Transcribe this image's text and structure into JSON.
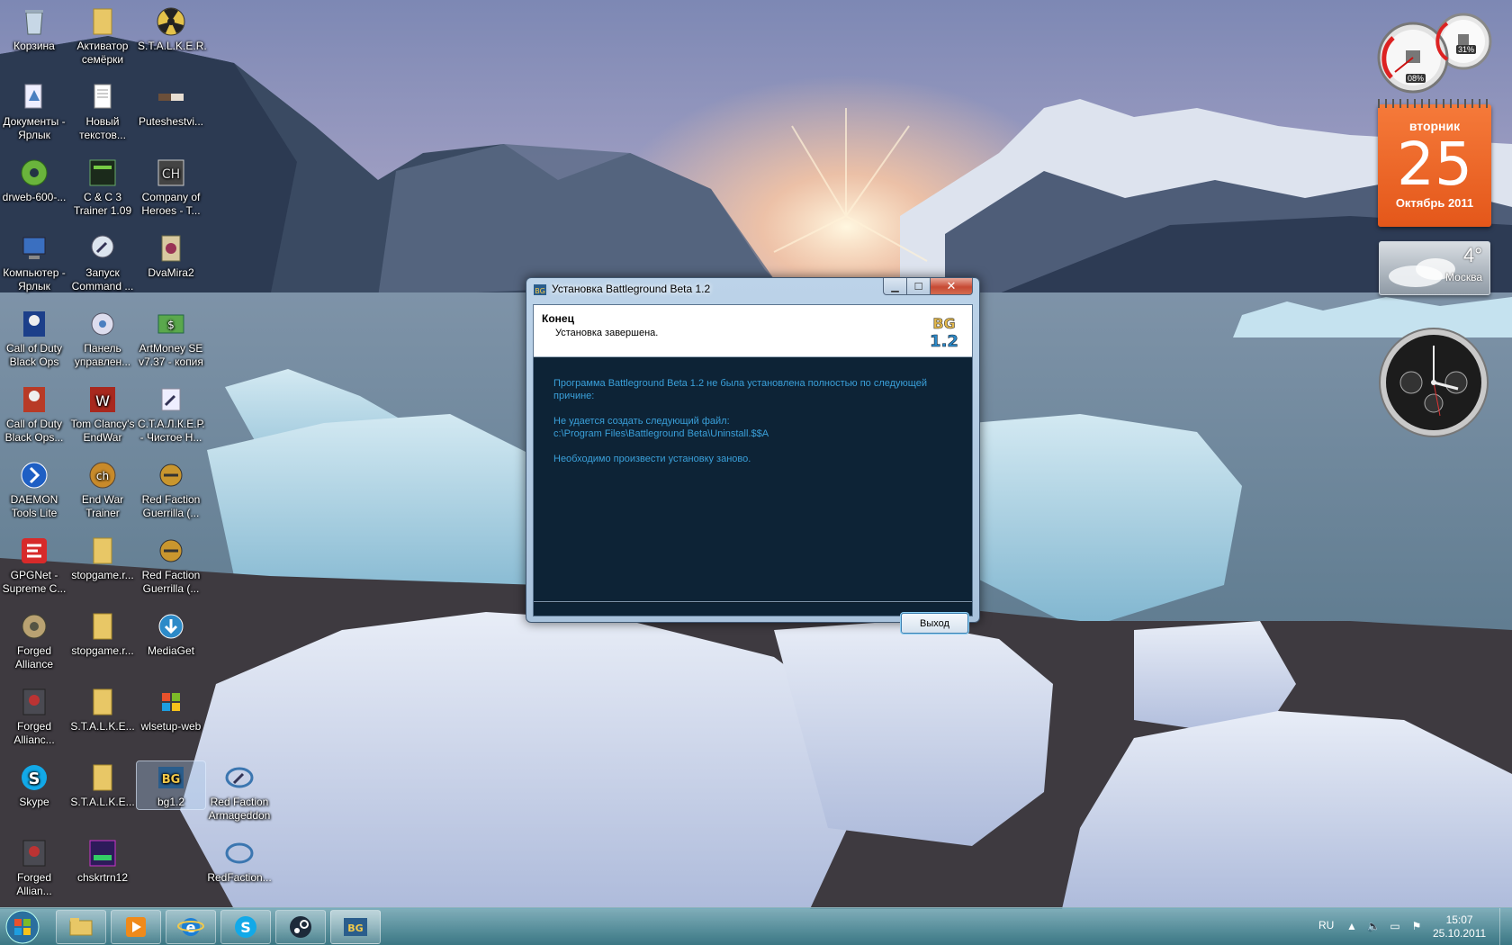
{
  "desktop": {
    "icons": [
      {
        "label": "Корзина"
      },
      {
        "label": "Активатор семёрки"
      },
      {
        "label": "S.T.A.L.K.E.R."
      },
      {
        "label": "Документы - Ярлык"
      },
      {
        "label": "Новый текстов..."
      },
      {
        "label": "Puteshestvi..."
      },
      {
        "label": "drweb-600-..."
      },
      {
        "label": "C & C 3 Trainer 1.09"
      },
      {
        "label": "Company of Heroes - T..."
      },
      {
        "label": "Компьютер - Ярлык"
      },
      {
        "label": "Запуск Command ..."
      },
      {
        "label": "DvaMira2"
      },
      {
        "label": "Call of Duty Black Ops"
      },
      {
        "label": "Панель управлен..."
      },
      {
        "label": "ArtMoney SE v7.37 - копия"
      },
      {
        "label": "Call of Duty Black Ops..."
      },
      {
        "label": "Tom Clancy's EndWar"
      },
      {
        "label": "С.Т.А.Л.К.Е.Р. - Чистое Н..."
      },
      {
        "label": "DAEMON Tools Lite"
      },
      {
        "label": "End War Trainer"
      },
      {
        "label": "Red Faction Guerrilla (..."
      },
      {
        "label": "GPGNet - Supreme C..."
      },
      {
        "label": "stopgame.r..."
      },
      {
        "label": "Red Faction Guerrilla (..."
      },
      {
        "label": "Forged Alliance"
      },
      {
        "label": "stopgame.r..."
      },
      {
        "label": "MediaGet"
      },
      {
        "label": "Forged Allianc..."
      },
      {
        "label": "S.T.A.L.K.E..."
      },
      {
        "label": "wlsetup-web"
      },
      {
        "label": "Skype"
      },
      {
        "label": "S.T.A.L.K.E..."
      },
      {
        "label": "bg1.2"
      },
      {
        "label": "Red Faction Armageddon"
      },
      {
        "label": "Forged Allian..."
      },
      {
        "label": "chskrtrn12"
      },
      {
        "label": "RedFaction..."
      }
    ]
  },
  "gadgets": {
    "meter": {
      "cpu": "08%",
      "ram": "31%"
    },
    "calendar": {
      "weekday": "вторник",
      "day": "25",
      "month_year": "Октябрь 2011"
    },
    "weather": {
      "temp": "4°",
      "city": "Москва"
    }
  },
  "dialog": {
    "title": "Установка Battleground Beta 1.2",
    "header_title": "Конец",
    "header_subtitle": "Установка завершена.",
    "logo_text": "1.2",
    "message": {
      "line1": "Программа Battleground Beta 1.2 не была установлена полностью по следующей причине:",
      "line2": "Не удается создать следующий файл:",
      "line3": "c:\\Program Files\\Battleground Beta\\Uninstall.$$A",
      "line4": "Необходимо произвести установку заново."
    },
    "exit_button": "Выход"
  },
  "taskbar": {
    "language": "RU",
    "time": "15:07",
    "date": "25.10.2011"
  },
  "colors": {
    "dialog_body": "#0d2336",
    "message_text": "#3aa0da",
    "calendar_orange": "#e4571a"
  }
}
